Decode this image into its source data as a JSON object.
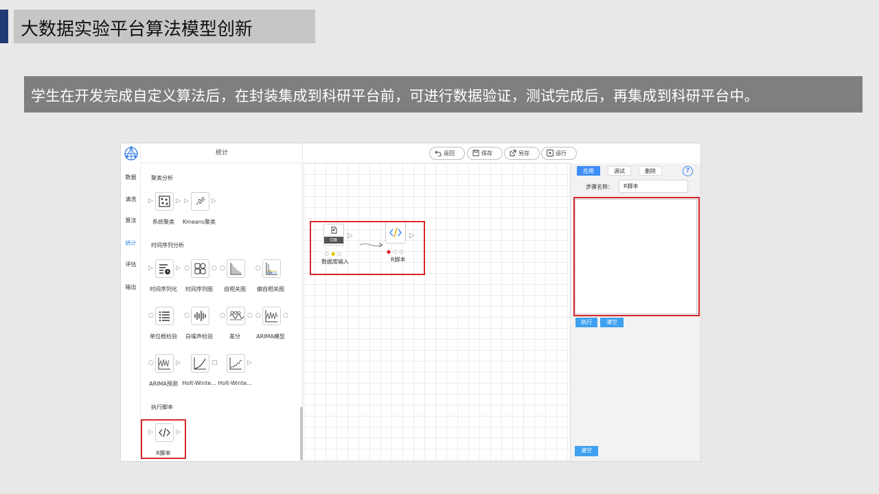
{
  "slide": {
    "title": "大数据实验平台算法模型创新",
    "subtitle": "学生在开发完成自定义算法后，在封装集成到科研平台前，可进行数据验证，测试完成后，再集成到科研平台中。"
  },
  "nav": {
    "items": [
      {
        "label": "数据"
      },
      {
        "label": "清洗"
      },
      {
        "label": "算法"
      },
      {
        "label": "统计",
        "active": true
      },
      {
        "label": "评估"
      },
      {
        "label": "输出"
      }
    ]
  },
  "palette": {
    "header": "统计",
    "sections": [
      {
        "title": "聚类分析"
      },
      {
        "title": "时间序列分析"
      },
      {
        "title": "执行脚本"
      }
    ],
    "components": [
      {
        "label": "系统聚类",
        "icon": "dots-cluster-icon"
      },
      {
        "label": "Kmeans聚类",
        "icon": "scatter-cluster-icon"
      },
      {
        "label": "时间序列化",
        "icon": "time-list-icon"
      },
      {
        "label": "时间序列图",
        "icon": "time-grid-icon"
      },
      {
        "label": "自相关图",
        "icon": "acf-chart-icon"
      },
      {
        "label": "偏自相关图",
        "icon": "pacf-chart-icon"
      },
      {
        "label": "单位根检验",
        "icon": "list-icon"
      },
      {
        "label": "白噪声检验",
        "icon": "noise-icon"
      },
      {
        "label": "差分",
        "icon": "wave-icon"
      },
      {
        "label": "ARIMA模型",
        "icon": "arima-icon"
      },
      {
        "label": "ARIMA预测",
        "icon": "arima-forecast-icon"
      },
      {
        "label": "Holt-Winte...",
        "icon": "holt-curve-icon"
      },
      {
        "label": "Holt-Winte...",
        "icon": "holt-series-icon"
      },
      {
        "label": "R脚本",
        "icon": "code-icon"
      }
    ]
  },
  "toolbar": {
    "back": "返回",
    "save": "保存",
    "save_as": "另存",
    "run": "运行"
  },
  "canvas": {
    "nodes": [
      {
        "label": "数据库输入",
        "badge": "DB"
      },
      {
        "label": "R脚本"
      }
    ]
  },
  "right_panel": {
    "tabs": [
      "应用",
      "调试",
      "删除"
    ],
    "help": "?",
    "step_name_label": "步骤名称：",
    "step_name_value": "R脚本",
    "execute": "执行",
    "clear": "清空",
    "clear_bottom": "清空"
  },
  "colors": {
    "title_accent": "#1f3a75",
    "subtitle_bg": "#7f7f7f",
    "active_tab": "#3e8ef7",
    "action_button": "#3ea0f0",
    "highlight": "#d9262a"
  }
}
